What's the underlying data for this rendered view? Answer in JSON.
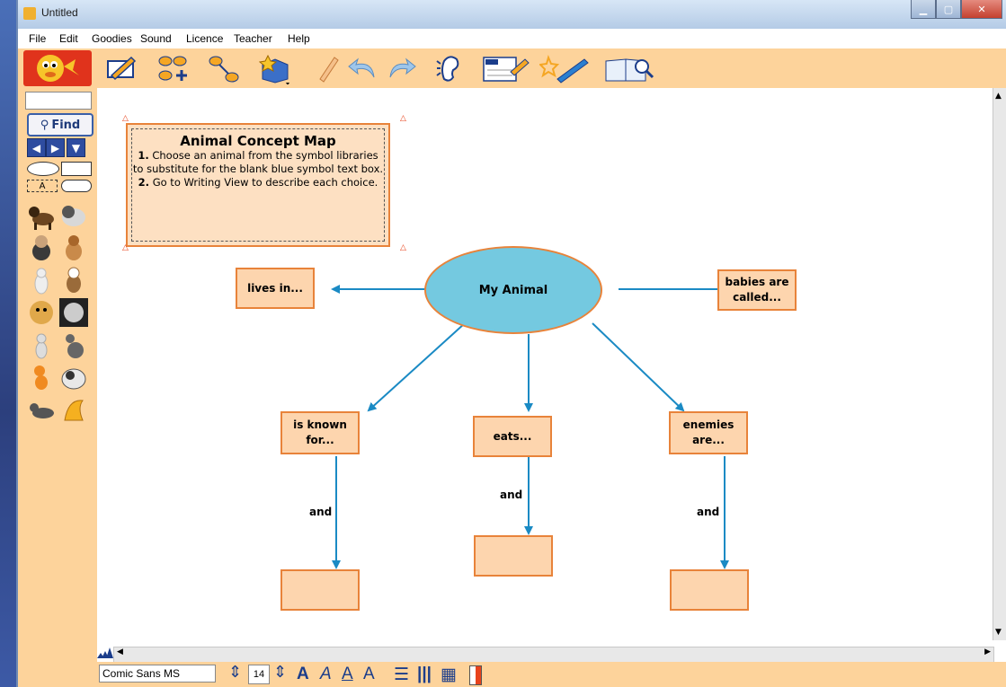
{
  "window": {
    "title": "Untitled"
  },
  "menu": [
    "File",
    "Edit",
    "Goodies",
    "Sound",
    "Licence",
    "Teacher",
    "Help"
  ],
  "toolbar": {
    "icons": [
      "edit-pencil-icon",
      "map-icon",
      "link-icon",
      "goodies-box-icon",
      "crayon-icon",
      "undo-icon",
      "redo-icon",
      "ear-icon",
      "name-card-icon",
      "magic-wand-icon",
      "book-magnifier-icon"
    ]
  },
  "left_panel": {
    "find_label": "Find",
    "text_shape_label": "A"
  },
  "concept_map": {
    "instruction": {
      "title": "Animal Concept Map",
      "step1_num": "1.",
      "step1": "Choose an animal from the symbol libraries to substitute for the blank blue symbol text box.",
      "step2_num": "2.",
      "step2": "Go to Writing View to describe each choice."
    },
    "center": "My Animal",
    "nodes": {
      "lives_in": "lives in...",
      "babies": "babies are called...",
      "known_for": "is known for...",
      "eats": "eats...",
      "enemies": "enemies are..."
    },
    "link_label": "and"
  },
  "statusbar": {
    "font": "Comic Sans MS",
    "size": "14"
  },
  "colors": {
    "box_fill": "#fdd5ae",
    "box_border": "#e8833a",
    "center_fill": "#74c9e0",
    "arrow": "#1a8ac4",
    "panel": "#fdd39b"
  }
}
